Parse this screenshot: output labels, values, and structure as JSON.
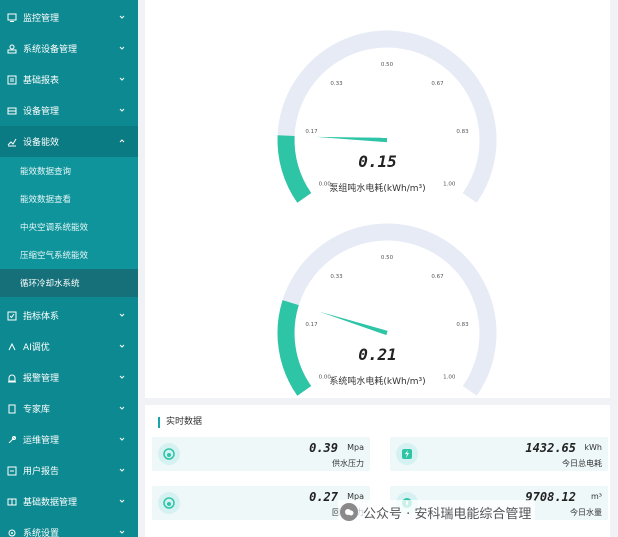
{
  "sidebar": {
    "items": [
      {
        "label": "监控管理",
        "icon": "monitor-icon",
        "expanded": false
      },
      {
        "label": "系统设备管理",
        "icon": "device-icon",
        "expanded": false
      },
      {
        "label": "基础报表",
        "icon": "report-icon",
        "expanded": false
      },
      {
        "label": "设备管理",
        "icon": "equipment-icon",
        "expanded": false
      },
      {
        "label": "设备能效",
        "icon": "efficiency-icon",
        "expanded": true
      },
      {
        "label": "指标体系",
        "icon": "index-icon",
        "expanded": false
      },
      {
        "label": "AI调优",
        "icon": "ai-icon",
        "expanded": false
      },
      {
        "label": "报警管理",
        "icon": "alarm-icon",
        "expanded": false
      },
      {
        "label": "专家库",
        "icon": "expert-icon",
        "expanded": false
      },
      {
        "label": "运维管理",
        "icon": "maintenance-icon",
        "expanded": false
      },
      {
        "label": "用户报告",
        "icon": "user-report-icon",
        "expanded": false
      },
      {
        "label": "基础数据管理",
        "icon": "data-icon",
        "expanded": false
      },
      {
        "label": "系统设置",
        "icon": "settings-icon",
        "expanded": false
      }
    ],
    "subitems": [
      {
        "label": "能效数据查询",
        "active": false
      },
      {
        "label": "能效数据查看",
        "active": false
      },
      {
        "label": "中央空调系统能效",
        "active": false
      },
      {
        "label": "压缩空气系统能效",
        "active": false
      },
      {
        "label": "循环冷却水系统",
        "active": true
      }
    ]
  },
  "gauges": [
    {
      "value": 0.15,
      "value_text": "0.15",
      "label": "泵组吨水电耗(kWh/m³)",
      "min": 0,
      "max": 1,
      "ticks": [
        "0.00",
        "0.17",
        "0.33",
        "0.50",
        "0.67",
        "0.83",
        "1.00"
      ]
    },
    {
      "value": 0.21,
      "value_text": "0.21",
      "label": "系统吨水电耗(kWh/m³)",
      "min": 0,
      "max": 1,
      "ticks": [
        "0.00",
        "0.17",
        "0.33",
        "0.50",
        "0.67",
        "0.83",
        "1.00"
      ]
    }
  ],
  "realtime": {
    "title": "实时数据",
    "metrics": [
      {
        "value": "0.39",
        "unit": "Mpa",
        "label": "供水压力",
        "icon": "pressure-icon"
      },
      {
        "value": "1432.65",
        "unit": "kWh",
        "label": "今日总电耗",
        "icon": "electricity-icon"
      },
      {
        "value": "0.27",
        "unit": "Mpa",
        "label": "回水压力",
        "icon": "pressure-icon"
      },
      {
        "value": "9708.12",
        "unit": "m³",
        "label": "今日水量",
        "icon": "water-icon"
      }
    ]
  },
  "watermark": "公众号 · 安科瑞电能综合管理",
  "colors": {
    "sidebar": "#0d8a91",
    "accent": "#2ec4a6",
    "gauge_track": "#e6ebf5"
  }
}
